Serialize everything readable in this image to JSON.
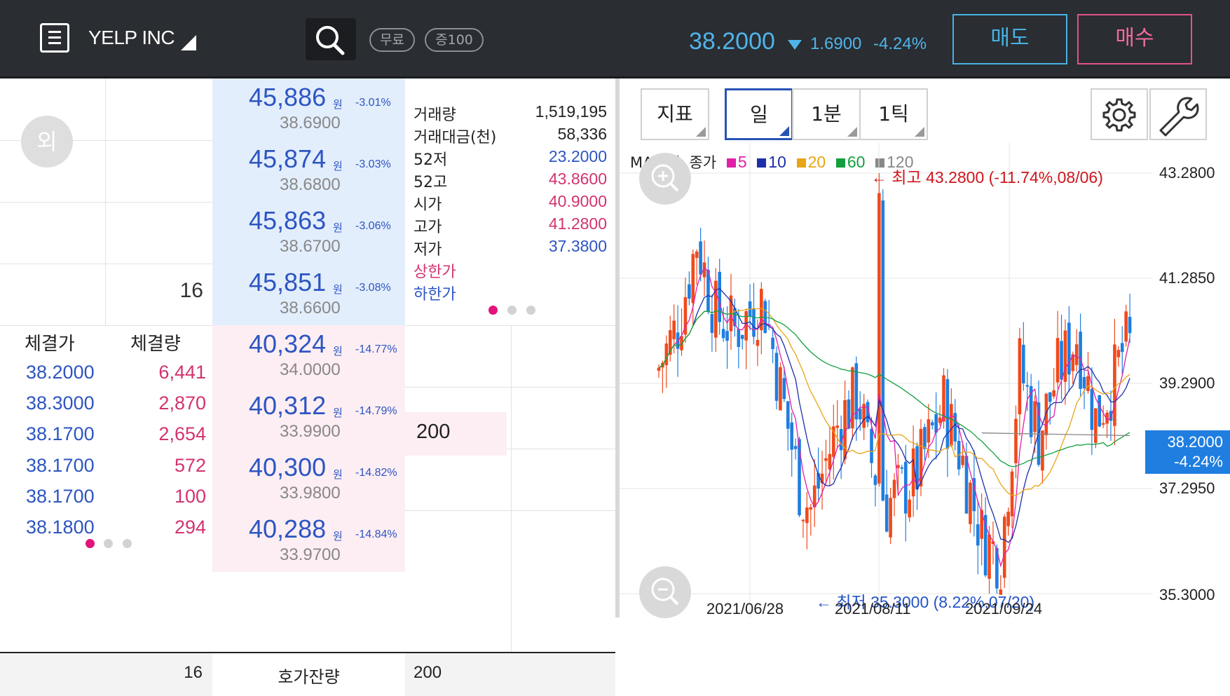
{
  "header": {
    "title": "YELP INC",
    "badge_free": "무료",
    "badge_margin": "증100",
    "price": "38.2000",
    "change": "1.6900",
    "change_pct": "-4.24%",
    "sell_label": "매도",
    "buy_label": "매수"
  },
  "orderbook": {
    "foreign_badge": "외",
    "asks": [
      {
        "krw": "45,886",
        "unit": "원",
        "pct": "-3.01%",
        "usd": "38.6900",
        "qty": ""
      },
      {
        "krw": "45,874",
        "unit": "원",
        "pct": "-3.03%",
        "usd": "38.6800",
        "qty": ""
      },
      {
        "krw": "45,863",
        "unit": "원",
        "pct": "-3.06%",
        "usd": "38.6700",
        "qty": ""
      },
      {
        "krw": "45,851",
        "unit": "원",
        "pct": "-3.08%",
        "usd": "38.6600",
        "qty": "16"
      }
    ],
    "bids": [
      {
        "krw": "40,324",
        "unit": "원",
        "pct": "-14.77%",
        "usd": "34.0000",
        "qty": "200"
      },
      {
        "krw": "40,312",
        "unit": "원",
        "pct": "-14.79%",
        "usd": "33.9900",
        "qty": ""
      },
      {
        "krw": "40,300",
        "unit": "원",
        "pct": "-14.82%",
        "usd": "33.9800",
        "qty": ""
      },
      {
        "krw": "40,288",
        "unit": "원",
        "pct": "-14.84%",
        "usd": "33.9700",
        "qty": ""
      }
    ],
    "info": [
      {
        "label": "거래량",
        "value": "1,519,195",
        "color": "#222222"
      },
      {
        "label": "거래대금(천)",
        "value": "58,336",
        "color": "#222222"
      },
      {
        "label": "52저",
        "value": "23.2000",
        "color": "#2d55c2"
      },
      {
        "label": "52고",
        "value": "43.8600",
        "color": "#d3336f"
      },
      {
        "label": "시가",
        "value": "40.9000",
        "color": "#d3336f"
      },
      {
        "label": "고가",
        "value": "41.2800",
        "color": "#d3336f"
      },
      {
        "label": "저가",
        "value": "37.3800",
        "color": "#2d55c2"
      },
      {
        "label": "상한가",
        "value": "",
        "color": "#d3336f"
      },
      {
        "label": "하한가",
        "value": "",
        "color": "#2d55c2"
      }
    ],
    "trades_header": {
      "price": "체결가",
      "volume": "체결량"
    },
    "trades": [
      {
        "price": "38.2000",
        "volume": "6,441"
      },
      {
        "price": "38.3000",
        "volume": "2,870"
      },
      {
        "price": "38.1700",
        "volume": "2,654"
      },
      {
        "price": "38.1700",
        "volume": "572"
      },
      {
        "price": "38.1700",
        "volume": "100"
      },
      {
        "price": "38.1800",
        "volume": "294"
      }
    ],
    "footer": {
      "ask_total": "16",
      "label": "호가잔량",
      "bid_total": "200"
    }
  },
  "chart": {
    "buttons": {
      "indicator": "지표",
      "day": "일",
      "minute": "1분",
      "tick": "1틱"
    },
    "selected_period": "일",
    "settings_icon": "gear-icon",
    "tools_icon": "wrench-icon",
    "legend": {
      "prefix": "MA 단순 종가",
      "items": [
        {
          "label": "5",
          "color": "#e020a8"
        },
        {
          "label": "10",
          "color": "#1d2fa8"
        },
        {
          "label": "20",
          "color": "#e8a514"
        },
        {
          "label": "60",
          "color": "#12a03c"
        },
        {
          "label": "120",
          "color": "#888888"
        }
      ]
    },
    "y_ticks": [
      "43.2800",
      "41.2850",
      "39.2900",
      "37.2950",
      "35.3000"
    ],
    "x_ticks": [
      "2021/06/28",
      "2021/08/11",
      "2021/09/24"
    ],
    "current_tag": {
      "price": "38.2000",
      "pct": "-4.24%"
    },
    "annotation_high": "← 최고 43.2800 (-11.74%,08/06)",
    "annotation_low": "← 최저 35.3000 (8.22%,07/20)",
    "up_color": "#f04a1c",
    "down_color": "#1f7ee0"
  }
}
